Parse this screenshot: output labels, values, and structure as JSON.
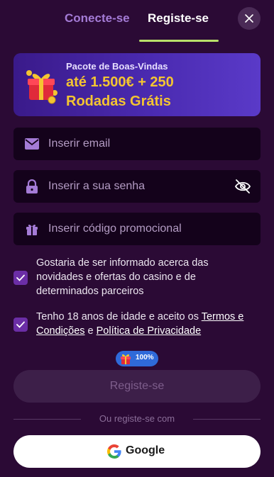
{
  "tabs": {
    "login_label": "Conecte-se",
    "register_label": "Registe-se"
  },
  "banner": {
    "small": "Pacote de Boas-Vindas",
    "line1": "até 1.500€ + 250",
    "line2": "Rodadas Grátis",
    "icon": "gift-icon"
  },
  "form": {
    "email_placeholder": "Inserir email",
    "password_placeholder": "Inserir a sua senha",
    "promo_placeholder": "Inserir código promocional"
  },
  "checkboxes": {
    "news_text": "Gostaria de ser informado acerca das novidades e ofertas do casino e de determinados parceiros",
    "age_prefix": "Tenho 18 anos de idade e aceito os ",
    "terms_link": "Termos e Condições",
    "and_text": " e ",
    "privacy_link": "Política de Privacidade",
    "news_checked": true,
    "age_checked": true
  },
  "progress": {
    "value": "100%"
  },
  "submit_label": "Registe-se",
  "divider_text": "Ou registe-se com",
  "google_label": "Google",
  "colors": {
    "background": "#2b0a35",
    "accent": "#b9e06a",
    "checkbox": "#6b2ea6",
    "gold": "#f4c531"
  }
}
